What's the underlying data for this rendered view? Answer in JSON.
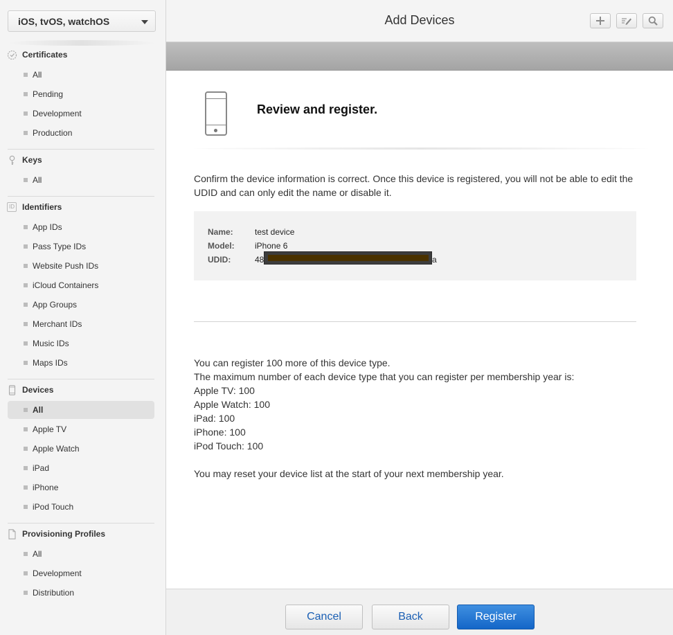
{
  "platform_select": {
    "value": "iOS, tvOS, watchOS"
  },
  "sidebar": {
    "certificates": {
      "title": "Certificates",
      "items": [
        "All",
        "Pending",
        "Development",
        "Production"
      ]
    },
    "keys": {
      "title": "Keys",
      "items": [
        "All"
      ]
    },
    "identifiers": {
      "title": "Identifiers",
      "icon_text": "ID",
      "items": [
        "App IDs",
        "Pass Type IDs",
        "Website Push IDs",
        "iCloud Containers",
        "App Groups",
        "Merchant IDs",
        "Music IDs",
        "Maps IDs"
      ]
    },
    "devices": {
      "title": "Devices",
      "items": [
        "All",
        "Apple TV",
        "Apple Watch",
        "iPad",
        "iPhone",
        "iPod Touch"
      ],
      "active": "All"
    },
    "profiles": {
      "title": "Provisioning Profiles",
      "items": [
        "All",
        "Development",
        "Distribution"
      ]
    }
  },
  "header": {
    "title": "Add Devices",
    "icons": [
      "plus-icon",
      "edit-icon",
      "search-icon"
    ]
  },
  "main": {
    "review_title": "Review and register.",
    "confirm_text": "Confirm the device information is correct. Once this device is registered, you will not be able to edit the UDID and can only edit the name or disable it.",
    "device": {
      "name_label": "Name:",
      "name": "test device",
      "model_label": "Model:",
      "model": "iPhone 6",
      "udid_label": "UDID:",
      "udid_prefix": "48",
      "udid_suffix": "a"
    },
    "limits": {
      "line1": "You can register 100 more of this device type.",
      "line2": "The maximum number of each device type that you can register per membership year is:",
      "apple_tv": "Apple TV: 100",
      "apple_watch": "Apple Watch: 100",
      "ipad": "iPad: 100",
      "iphone": "iPhone: 100",
      "ipod": "iPod Touch: 100",
      "reset": "You may reset your device list at the start of your next membership year."
    }
  },
  "footer": {
    "cancel": "Cancel",
    "back": "Back",
    "register": "Register"
  },
  "colors": {
    "accent": "#1466c8",
    "sidebar_bg": "#f4f4f4",
    "active_item_bg": "#e1e1e1"
  }
}
